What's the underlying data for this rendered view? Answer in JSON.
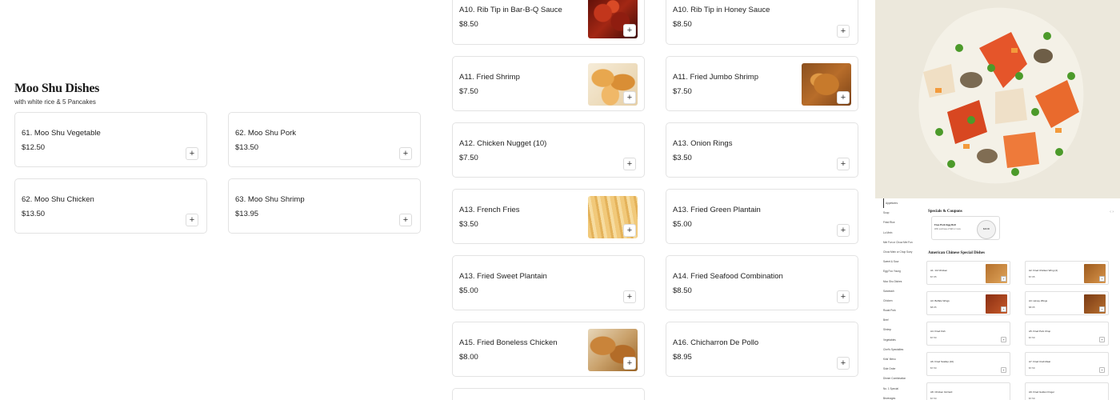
{
  "section": {
    "title": "Moo Shu Dishes",
    "subtitle": "with white rice & 5 Pancakes"
  },
  "moo_shu_items": [
    {
      "name": "61. Moo Shu Vegetable",
      "price": "$12.50"
    },
    {
      "name": "62. Moo Shu Pork",
      "price": "$13.50"
    },
    {
      "name": "62. Moo Shu Chicken",
      "price": "$13.50"
    },
    {
      "name": "63. Moo Shu Shrimp",
      "price": "$13.95"
    }
  ],
  "menu_items": [
    {
      "name": "A10. Rib Tip in Bar-B-Q Sauce",
      "price": "$8.50",
      "image": "rib-tips-photo"
    },
    {
      "name": "A10. Rib Tip in Honey Sauce",
      "price": "$8.50"
    },
    {
      "name": "A11. Fried Shrimp",
      "price": "$7.50",
      "image": "fried-shrimp-photo"
    },
    {
      "name": "A11. Fried Jumbo Shrimp",
      "price": "$7.50",
      "image": "jumbo-shrimp-photo"
    },
    {
      "name": "A12. Chicken Nugget (10)",
      "price": "$7.50"
    },
    {
      "name": "A13. Onion Rings",
      "price": "$3.50"
    },
    {
      "name": "A13. French Fries",
      "price": "$3.50",
      "image": "french-fries-photo"
    },
    {
      "name": "A13. Fried Green Plantain",
      "price": "$5.00"
    },
    {
      "name": "A13. Fried Sweet Plantain",
      "price": "$5.00"
    },
    {
      "name": "A14. Fried Seafood Combination",
      "price": "$8.50"
    },
    {
      "name": "A15. Fried Boneless Chicken",
      "price": "$8.00",
      "image": "boneless-chicken-photo"
    },
    {
      "name": "A16. Chicharron De Pollo",
      "price": "$8.95"
    }
  ],
  "icons": {
    "add": "plus-icon"
  },
  "side_panel": {
    "photo": "lobster-dish-photo",
    "nav": [
      "Appetizers",
      "Soup",
      "Fried Rice",
      "Lo Mein",
      "Mei Fun or Chow Mei Fun",
      "Chow Mein or Chop Suey",
      "Sweet & Sour",
      "Egg Foo Young",
      "Moo Shu Dishes",
      "Sandwich",
      "Chicken",
      "Roast Pork",
      "Beef",
      "Shrimp",
      "Vegetables",
      "Chef's Specialties",
      "Kids' Menu",
      "Side Order",
      "Dinner Combination",
      "No. 1 Special",
      "Beverages"
    ],
    "specials_title": "Specials & Coupons",
    "promo_title": "Free Pork Egg Roll",
    "promo_sub": "With purchase of $20 or more",
    "promo_coupon": "$20.00",
    "subsection": "American Chinese Special Dishes",
    "items": [
      {
        "name": "A1. 1/2 Chicken",
        "price": "$7.95"
      },
      {
        "name": "A2. Fried Chicken Wing (4)",
        "price": "$7.95"
      },
      {
        "name": "A3. Buffalo Wings",
        "price": "$8.95"
      },
      {
        "name": "A3. Honey Wings",
        "price": "$8.95"
      },
      {
        "name": "A4. Fried Fish",
        "price": "$7.50"
      },
      {
        "name": "A5. Fried Pork Chop",
        "price": "$7.50"
      },
      {
        "name": "A6. Fried Scallop (10)",
        "price": "$7.50"
      },
      {
        "name": "A7. Fried Crab Meat",
        "price": "$7.50"
      },
      {
        "name": "A8. Chicken Gizzard",
        "price": "$7.50"
      },
      {
        "name": "A9. Fried Golden Finger",
        "price": "$7.50"
      }
    ]
  }
}
